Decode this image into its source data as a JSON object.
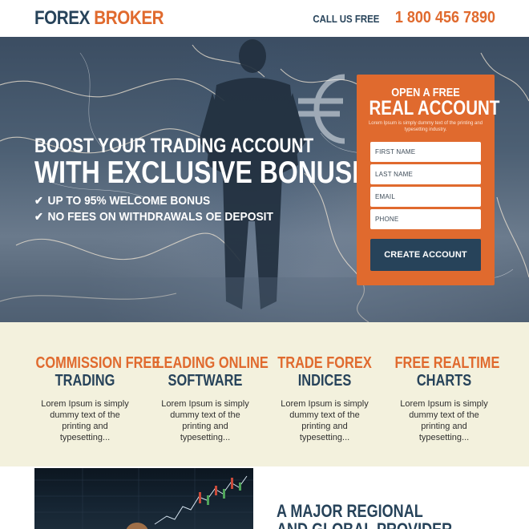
{
  "header": {
    "logo_part1": "FOREX",
    "logo_part2": "BROKER",
    "call_label": "CALL US FREE",
    "phone": "1 800 456 7890"
  },
  "hero": {
    "line1": "BOOST YOUR TRADING ACCOUNT",
    "line2": "WITH EXCLUSIVE BONUSES",
    "bullets": [
      "UP TO 95% WELCOME BONUS",
      "NO FEES ON WITHDRAWALS OE DEPOSIT"
    ],
    "check_icon": "✔"
  },
  "form": {
    "title_small": "OPEN A FREE",
    "title_large": "REAL ACCOUNT",
    "description": "Lorem Ipsum is simply dummy text of the printing and typesetting industry.",
    "fields": [
      {
        "placeholder": "FIRST NAME"
      },
      {
        "placeholder": "LAST NAME"
      },
      {
        "placeholder": "EMAIL"
      },
      {
        "placeholder": "PHONE"
      }
    ],
    "submit_label": "CREATE ACCOUNT"
  },
  "features": [
    {
      "title1": "COMMISSION FREE",
      "title2": "TRADING",
      "desc": "Lorem Ipsum is simply dummy text of the printing and typesetting..."
    },
    {
      "title1": "LEADING ONLINE",
      "title2": "SOFTWARE",
      "desc": "Lorem Ipsum is simply dummy text of the printing and typesetting..."
    },
    {
      "title1": "TRADE FOREX",
      "title2": "INDICES",
      "desc": "Lorem Ipsum is simply dummy text of the printing and typesetting..."
    },
    {
      "title1": "FREE REALTIME",
      "title2": "CHARTS",
      "desc": "Lorem Ipsum is simply dummy text of the printing and typesetting..."
    }
  ],
  "bottom": {
    "heading_line1": "A MAJOR REGIONAL",
    "heading_line2": "AND GLOBAL PROVIDER"
  },
  "colors": {
    "navy": "#27435a",
    "orange": "#e06a2e",
    "cream": "#f3f1dd"
  }
}
